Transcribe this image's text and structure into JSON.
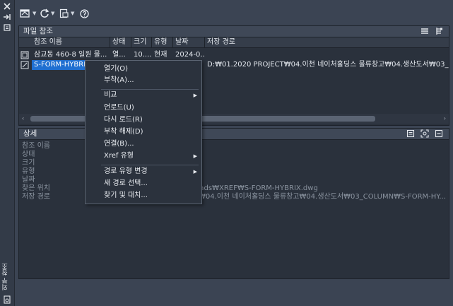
{
  "sidebar": {
    "title": "외부 참조"
  },
  "file_panel": {
    "title": "파일 참조",
    "columns": [
      "참조 이름",
      "상태",
      "크기",
      "유형",
      "날짜",
      "저장 경로"
    ],
    "rows": [
      {
        "name": "삼교동 460-8 일원 물...",
        "status": "열...",
        "size": "10....",
        "type": "현재",
        "date": "2024-0...",
        "path": ""
      },
      {
        "name": "S-FORM-HYBRIX",
        "status": "",
        "size": "",
        "type": "",
        "date": "",
        "path": "D:₩01.2020 PROJECT₩04.이천 네이처홀딩스 물류창고₩04.생산도서₩03_C"
      }
    ]
  },
  "detail_panel": {
    "title": "상세",
    "labels": [
      "참조 이름",
      "상태",
      "크기",
      "유형",
      "날짜",
      "찾은 위치",
      "저장 경로"
    ],
    "found_at": "wnloads₩XREF₩S-FORM-HYBRIX.dwg",
    "saved_path": "₩04.이천 네이처홀딩스 물류창고₩04.생산도서₩03_COLUMN₩S-FORM-HY..."
  },
  "context_menu": {
    "items": [
      {
        "label": "열기(O)",
        "submenu": false
      },
      {
        "label": "부착(A)...",
        "submenu": false
      },
      {
        "label": "비교",
        "submenu": true
      },
      {
        "label": "언로드(U)",
        "submenu": false
      },
      {
        "label": "다시 로드(R)",
        "submenu": false
      },
      {
        "label": "부착 해제(D)",
        "submenu": false
      },
      {
        "label": "연결(B)...",
        "submenu": false
      },
      {
        "label": "Xref 유형",
        "submenu": true
      },
      {
        "label": "경로 유형 변경",
        "submenu": true
      },
      {
        "label": "새 경로 선택...",
        "submenu": false
      },
      {
        "label": "찾기 및 대치...",
        "submenu": false
      }
    ]
  },
  "colors": {
    "selection": "#1f6fd1",
    "panel": "#2a313c",
    "header": "#3f4857"
  }
}
